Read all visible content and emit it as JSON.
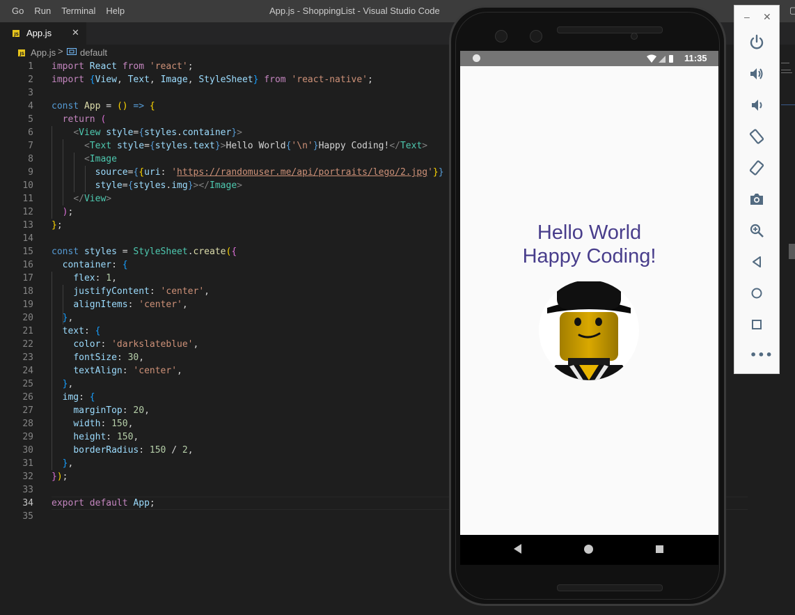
{
  "titlebar": {
    "menu": [
      "Go",
      "Run",
      "Terminal",
      "Help"
    ],
    "window_title": "App.js - ShoppingList - Visual Studio Code"
  },
  "tab": {
    "label": "App.js",
    "icon": "js-file-icon",
    "close": "✕"
  },
  "breadcrumb": {
    "file": "App.js",
    "symbol": "default",
    "separator": ">"
  },
  "editor": {
    "active_line": 34,
    "line_numbers": [
      "1",
      "2",
      "3",
      "4",
      "5",
      "6",
      "7",
      "8",
      "9",
      "10",
      "11",
      "12",
      "13",
      "14",
      "15",
      "16",
      "17",
      "18",
      "19",
      "20",
      "21",
      "22",
      "23",
      "24",
      "25",
      "26",
      "27",
      "28",
      "29",
      "30",
      "31",
      "32",
      "33",
      "34",
      "35"
    ],
    "lines": [
      "import React from 'react';",
      "import {View, Text, Image, StyleSheet} from 'react-native';",
      "",
      "const App = () => {",
      "  return (",
      "    <View style={styles.container}>",
      "      <Text style={styles.text}>Hello World{'\\n'}Happy Coding!</Text>",
      "      <Image",
      "        source={{uri: 'https://randomuser.me/api/portraits/lego/2.jpg'}}",
      "        style={styles.img}></Image>",
      "    </View>",
      "  );",
      "};",
      "",
      "const styles = StyleSheet.create({",
      "  container: {",
      "    flex: 1,",
      "    justifyContent: 'center',",
      "    alignItems: 'center',",
      "  },",
      "  text: {",
      "    color: 'darkslateblue',",
      "    fontSize: 30,",
      "    textAlign: 'center',",
      "  },",
      "  img: {",
      "    marginTop: 20,",
      "    width: 150,",
      "    height: 150,",
      "    borderRadius: 150 / 2,",
      "  },",
      "});",
      "",
      "export default App;",
      ""
    ]
  },
  "emulator": {
    "status_time": "11:35",
    "screen_text": [
      "Hello World",
      "Happy Coding!"
    ],
    "text_color": "#483d8b",
    "image": "lego-figure-avatar",
    "nav_buttons": [
      "back",
      "home",
      "recents"
    ]
  },
  "emulator_toolbar": {
    "window_buttons": [
      "–",
      "✕"
    ],
    "buttons": [
      "power-icon",
      "volume-up-icon",
      "volume-down-icon",
      "rotate-left-icon",
      "rotate-right-icon",
      "screenshot-icon",
      "zoom-icon",
      "back-icon",
      "home-icon",
      "overview-icon",
      "more-icon"
    ],
    "more_label": "•••"
  },
  "colors": {
    "editor_bg": "#1e1e1e",
    "keyword": "#c586c0",
    "string": "#ce9178",
    "variable": "#9cdcfe",
    "function": "#dcdcaa",
    "type": "#4ec9b0",
    "number": "#b5cea8"
  }
}
